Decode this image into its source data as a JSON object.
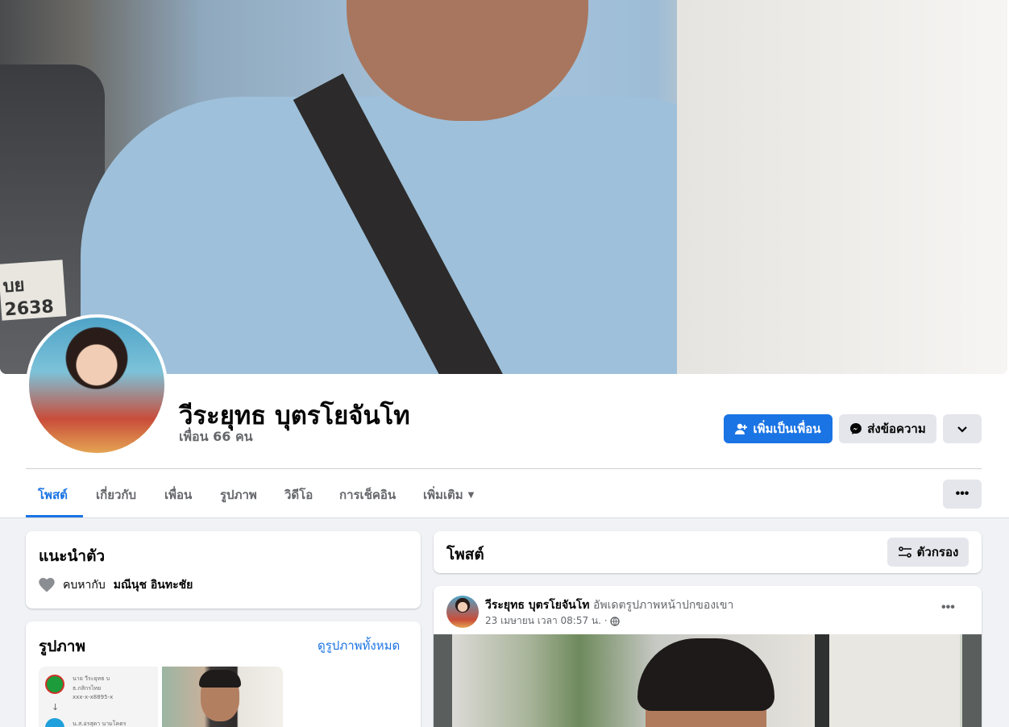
{
  "profile": {
    "name": "วีระยุทธ บุตรโยจันโท",
    "friends": "เพื่อน 66 คน",
    "cover_plate": "บย 2638"
  },
  "actions": {
    "add_friend": "เพิ่มเป็นเพื่อน",
    "message": "ส่งข้อความ"
  },
  "tabs": [
    {
      "label": "โพสต์",
      "active": true
    },
    {
      "label": "เกี่ยวกับ"
    },
    {
      "label": "เพื่อน"
    },
    {
      "label": "รูปภาพ"
    },
    {
      "label": "วิดีโอ"
    },
    {
      "label": "การเช็คอิน"
    },
    {
      "label": "เพิ่มเติม"
    }
  ],
  "intro": {
    "title": "แนะนำตัว",
    "relationship_prefix": "คบหากับ",
    "relationship_name": "มณีนุช อินทะชัย"
  },
  "photos": {
    "title": "รูปภาพ",
    "see_all": "ดูรูปภาพทั้งหมด",
    "doc_lines": [
      "นาย วีระยุทธ บ",
      "ธ.กสิกรไทย",
      "xxx-x-x8895-x",
      "น.ส.อรสุดา นามโคตร"
    ]
  },
  "posts_header": {
    "title": "โพสต์",
    "filter": "ตัวกรอง"
  },
  "post": {
    "author": "วีระยุทธ บุตรโยจันโท",
    "action": "อัพเดตรูปภาพหน้าปกของเขา",
    "time": "23 เมษายน เวลา 08:57 น. ·"
  },
  "colors": {
    "accent": "#1b74e4",
    "background": "#f0f2f5",
    "secondary_text": "#65676b"
  }
}
